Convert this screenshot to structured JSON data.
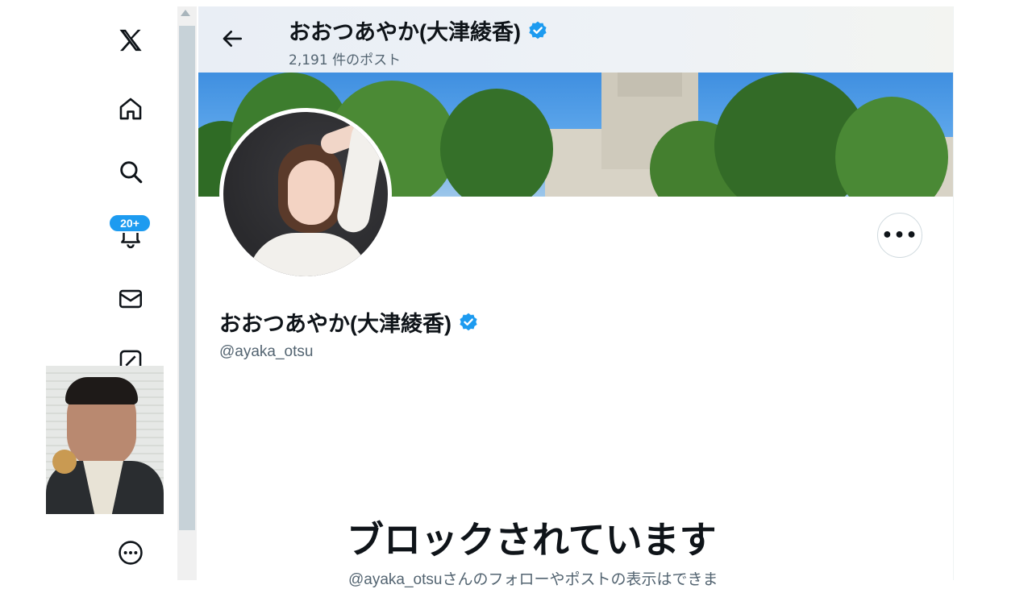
{
  "nav": {
    "items": [
      {
        "name": "x-logo-icon"
      },
      {
        "name": "home-icon"
      },
      {
        "name": "search-icon"
      },
      {
        "name": "bell-icon"
      },
      {
        "name": "mail-icon"
      },
      {
        "name": "compose-icon"
      },
      {
        "name": "more-circle-icon"
      }
    ],
    "notification_badge": "20+"
  },
  "header": {
    "name": "おおつあやか(大津綾香)",
    "post_count": "2,191 件のポスト"
  },
  "profile": {
    "display_name": "おおつあやか(大津綾香)",
    "handle": "@ayaka_otsu",
    "more_button": "•••"
  },
  "blocked": {
    "title": "ブロックされています",
    "subtitle": "@ayaka_otsuさんのフォローやポストの表示はできま"
  },
  "colors": {
    "accent": "#1d9bf0",
    "muted_text": "#536471",
    "text": "#0f1419"
  }
}
